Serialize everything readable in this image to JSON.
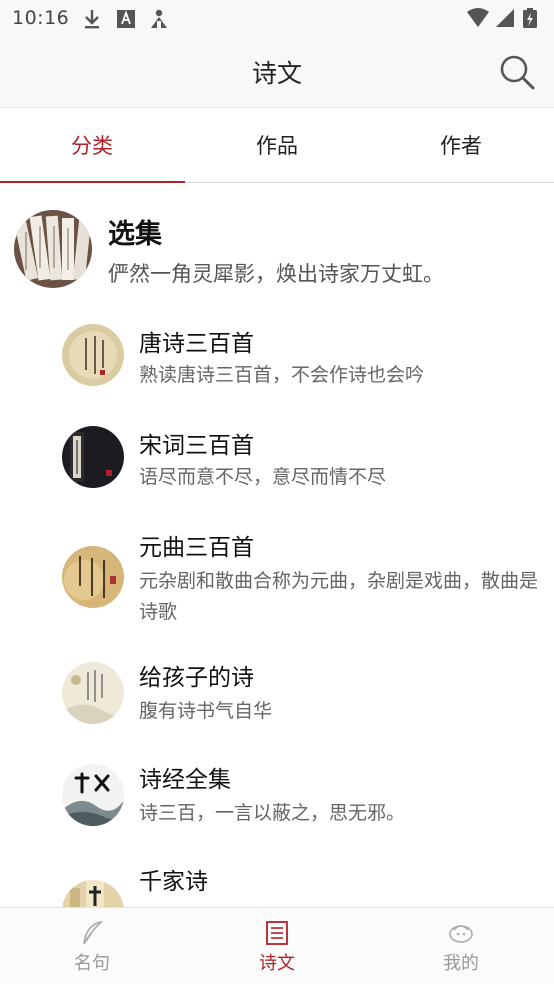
{
  "status": {
    "time": "10:16",
    "left_icons": [
      "download-icon",
      "a-icon",
      "tray-icon"
    ],
    "right_icons": [
      "wifi-icon",
      "signal-icon",
      "battery-icon"
    ]
  },
  "appbar": {
    "title": "诗文",
    "search_icon": "search-icon"
  },
  "tabs": [
    {
      "label": "分类",
      "active": true
    },
    {
      "label": "作品",
      "active": false
    },
    {
      "label": "作者",
      "active": false
    }
  ],
  "collection": {
    "title": "选集",
    "subtitle": "俨然一角灵犀影，焕出诗家万丈虹。"
  },
  "items": [
    {
      "title": "唐诗三百首",
      "subtitle": "熟读唐诗三百首，不会作诗也会吟"
    },
    {
      "title": "宋词三百首",
      "subtitle": "语尽而意不尽，意尽而情不尽"
    },
    {
      "title": "元曲三百首",
      "subtitle": "元杂剧和散曲合称为元曲，杂剧是戏曲，散曲是诗歌"
    },
    {
      "title": "给孩子的诗",
      "subtitle": "腹有诗书气自华"
    },
    {
      "title": "诗经全集",
      "subtitle": "诗三百，一言以蔽之，思无邪。"
    },
    {
      "title": "千家诗",
      "subtitle": ""
    }
  ],
  "bottomnav": [
    {
      "label": "名句",
      "icon": "quill-icon",
      "active": false
    },
    {
      "label": "诗文",
      "icon": "document-icon",
      "active": true
    },
    {
      "label": "我的",
      "icon": "profile-icon",
      "active": false
    }
  ],
  "colors": {
    "accent": "#b0222a",
    "muted": "#999999"
  }
}
